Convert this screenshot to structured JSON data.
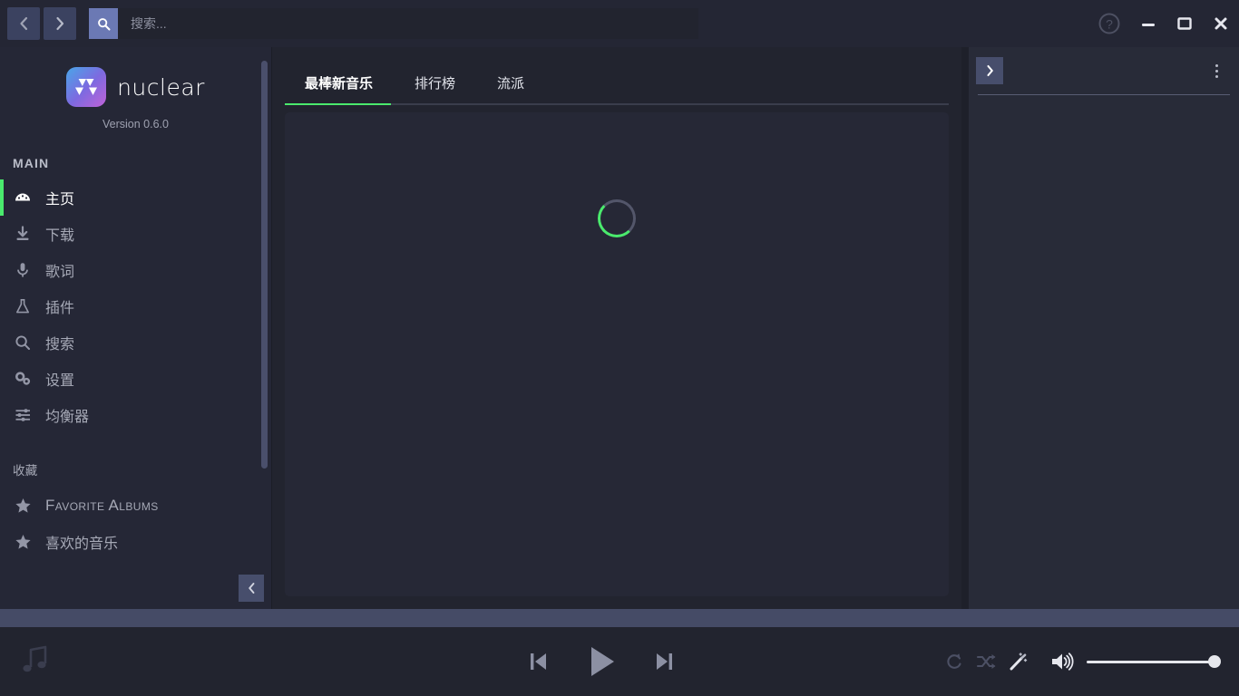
{
  "window": {
    "nav_back_label": "Back",
    "nav_forward_label": "Forward",
    "help_label": "Help",
    "minimize_label": "Minimize",
    "maximize_label": "Maximize",
    "close_label": "Close"
  },
  "search": {
    "placeholder": "搜索...",
    "value": "",
    "button_label": "搜索"
  },
  "sidebar": {
    "brand_name": "nuclear",
    "version": "Version 0.6.0",
    "section_main": "MAIN",
    "section_favorites": "收藏",
    "items": [
      {
        "label": "主页",
        "icon": "dashboard-icon",
        "active": true
      },
      {
        "label": "下载",
        "icon": "download-icon",
        "active": false
      },
      {
        "label": "歌词",
        "icon": "microphone-icon",
        "active": false
      },
      {
        "label": "插件",
        "icon": "flask-icon",
        "active": false
      },
      {
        "label": "搜索",
        "icon": "search-icon",
        "active": false
      },
      {
        "label": "设置",
        "icon": "gears-icon",
        "active": false
      },
      {
        "label": "均衡器",
        "icon": "sliders-icon",
        "active": false
      }
    ],
    "favorites": [
      {
        "label": "Favorite Albums",
        "icon": "star-icon"
      },
      {
        "label": "喜欢的音乐",
        "icon": "star-icon"
      }
    ],
    "collapse_label": "收起侧边栏"
  },
  "main": {
    "tabs": [
      {
        "label": "最棒新音乐",
        "active": true
      },
      {
        "label": "排行榜",
        "active": false
      },
      {
        "label": "流派",
        "active": false
      }
    ],
    "loading": true
  },
  "right_panel": {
    "expand_label": "展开队列",
    "menu_label": "更多选项"
  },
  "player": {
    "now_playing_icon": "music-note-icon",
    "previous_label": "上一首",
    "play_label": "播放",
    "next_label": "下一首",
    "repeat_label": "循环",
    "shuffle_label": "随机",
    "autoradio_label": "自动电台",
    "volume_label": "音量",
    "volume_value": 100,
    "seek_value": 0
  },
  "colors": {
    "accent_green": "#4aea6d",
    "topbar_bg": "#242634",
    "sidebar_bg": "#252736",
    "main_bg": "#22242f",
    "panel_bg": "#262836",
    "right_panel_bg": "#282b38",
    "button_slate": "#3b4260",
    "search_button": "#6b79b4",
    "seek_band": "#454b66",
    "text_muted": "#a6a9b6"
  }
}
